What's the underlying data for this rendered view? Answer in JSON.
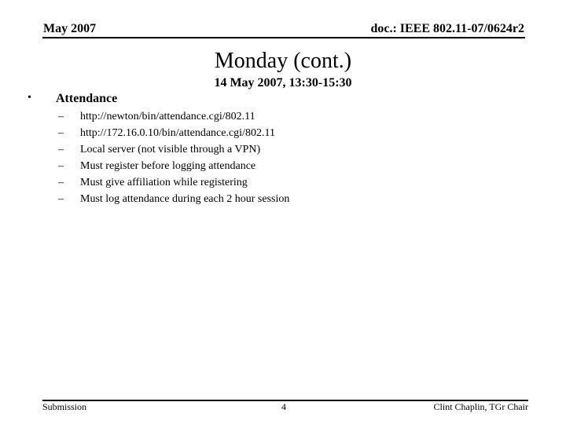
{
  "header": {
    "date": "May 2007",
    "doc_id": "doc.: IEEE 802.11-07/0624r2"
  },
  "slide": {
    "title": "Monday (cont.)",
    "subtitle": "14 May 2007, 13:30-15:30",
    "bullet": {
      "symbol": "•",
      "label": "Attendance",
      "dash_symbol": "–",
      "items": [
        "http://newton/bin/attendance.cgi/802.11",
        "http://172.16.0.10/bin/attendance.cgi/802.11",
        "Local server (not visible through a VPN)",
        "Must register before logging attendance",
        "Must give affiliation while registering",
        "Must log attendance during each 2 hour session"
      ]
    }
  },
  "footer": {
    "left": "Submission",
    "page_number": "4",
    "right": "Clint Chaplin, TGr Chair"
  }
}
